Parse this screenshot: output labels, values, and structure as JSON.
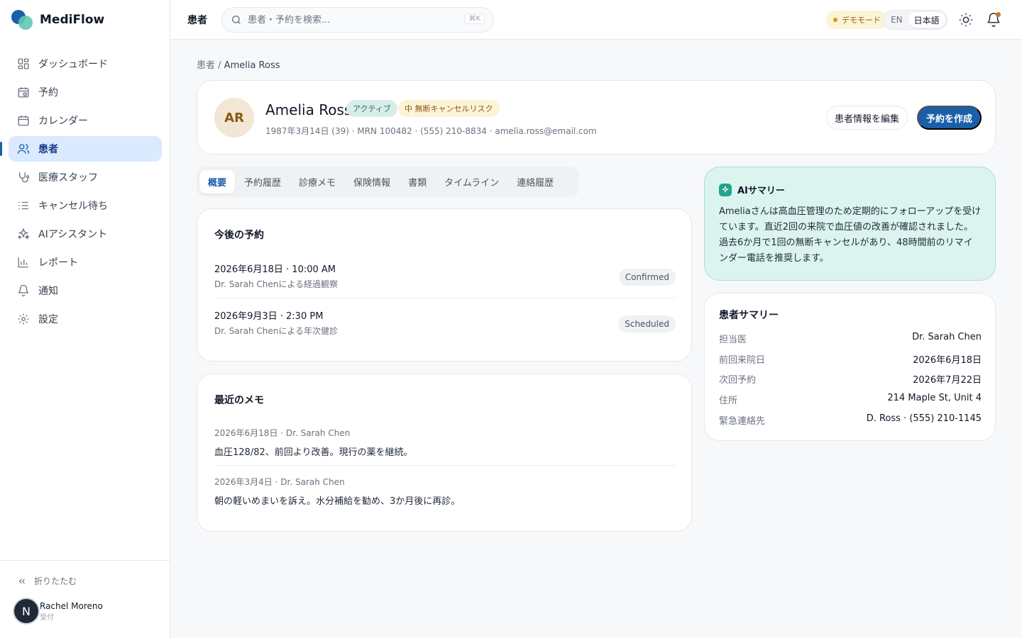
{
  "app": {
    "name": "MediFlow"
  },
  "nav": [
    {
      "key": "dashboard",
      "label": "ダッシュボード",
      "icon": "dashboard-icon",
      "active": false
    },
    {
      "key": "appointments",
      "label": "予約",
      "icon": "calendar-clock-icon",
      "active": false
    },
    {
      "key": "calendar",
      "label": "カレンダー",
      "icon": "calendar-icon",
      "active": false
    },
    {
      "key": "patients",
      "label": "患者",
      "icon": "users-icon",
      "active": true
    },
    {
      "key": "staff",
      "label": "医療スタッフ",
      "icon": "stethoscope-icon",
      "active": false
    },
    {
      "key": "waitlist",
      "label": "キャンセル待ち",
      "icon": "list-icon",
      "active": false
    },
    {
      "key": "ai",
      "label": "AIアシスタント",
      "icon": "sparkles-icon",
      "active": false
    },
    {
      "key": "reports",
      "label": "レポート",
      "icon": "bar-chart-icon",
      "active": false
    },
    {
      "key": "notifications",
      "label": "通知",
      "icon": "bell-icon",
      "active": false
    },
    {
      "key": "settings",
      "label": "設定",
      "icon": "gear-icon",
      "active": false
    }
  ],
  "sidebar_footer": {
    "collapse_label": "折りたたむ",
    "user": {
      "initial": "N",
      "name": "Rachel Moreno",
      "role": "受付"
    }
  },
  "topbar": {
    "title": "患者",
    "search_placeholder": "患者・予約を検索...",
    "search_shortcut": "⌘K",
    "demo_badge": "デモモード",
    "lang_en": "EN",
    "lang_ja": "日本語"
  },
  "breadcrumb": {
    "parent": "患者",
    "separator": " / ",
    "current": "Amelia Ross"
  },
  "patient": {
    "initials": "AR",
    "name": "Amelia Ross",
    "status": "アクティブ",
    "risk": "中 無断キャンセルリスク",
    "meta": "1987年3月14日 (39) · MRN 100482 · (555) 210-8834 · amelia.ross@email.com",
    "edit_label": "患者情報を編集",
    "create_label": "予約を作成"
  },
  "tabs": [
    "概要",
    "予約履歴",
    "診療メモ",
    "保険情報",
    "書類",
    "タイムライン",
    "連絡履歴"
  ],
  "upcoming": {
    "title": "今後の予約",
    "items": [
      {
        "date": "2026年6月18日 · 10:00 AM",
        "sub": "Dr. Sarah Chenによる経過観察",
        "status": "Confirmed"
      },
      {
        "date": "2026年9月3日 · 2:30 PM",
        "sub": "Dr. Sarah Chenによる年次健診",
        "status": "Scheduled"
      }
    ]
  },
  "notes": {
    "title": "最近のメモ",
    "items": [
      {
        "meta": "2026年6月18日 · Dr. Sarah Chen",
        "text": "血圧128/82、前回より改善。現行の薬を継続。"
      },
      {
        "meta": "2026年3月4日 · Dr. Sarah Chen",
        "text": "朝の軽いめまいを訴え。水分補給を勧め、3か月後に再診。"
      }
    ]
  },
  "ai_summary": {
    "title": "AIサマリー",
    "text": "Ameliaさんは高血圧管理のため定期的にフォローアップを受けています。直近2回の来院で血圧値の改善が確認されました。過去6か月で1回の無断キャンセルがあり、48時間前のリマインダー電話を推奨します。"
  },
  "patient_summary": {
    "title": "患者サマリー",
    "rows": [
      {
        "label": "担当医",
        "value": "Dr. Sarah Chen"
      },
      {
        "label": "前回来院日",
        "value": "2026年6月18日"
      },
      {
        "label": "次回予約",
        "value": "2026年7月22日"
      },
      {
        "label": "住所",
        "value": "214 Maple St, Unit 4"
      },
      {
        "label": "緊急連絡先",
        "value": "D. Ross · (555) 210-1145"
      }
    ]
  },
  "colors": {
    "primary": "#1a5fa8",
    "accent": "#5ec8b5",
    "ai_bg": "#dcf4ef",
    "warning": "#fdf3d7"
  }
}
